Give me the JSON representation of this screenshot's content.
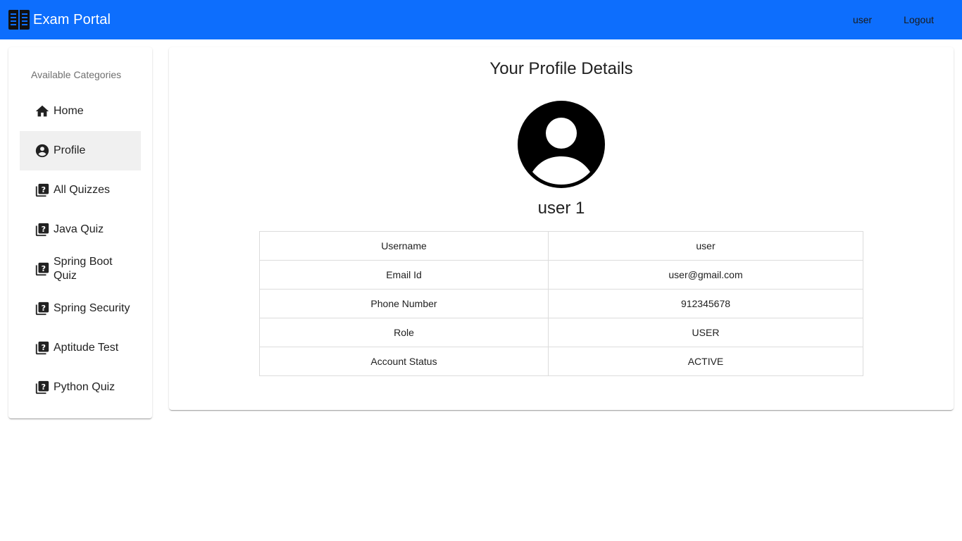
{
  "app": {
    "title": "Exam Portal",
    "brand_icon": "book-icon",
    "accent_color": "#0d6efd"
  },
  "header": {
    "user_label": "user",
    "logout_label": "Logout"
  },
  "sidebar": {
    "heading": "Available Categories",
    "items": [
      {
        "label": "Home",
        "icon": "home-icon"
      },
      {
        "label": "Profile",
        "icon": "account-circle-icon",
        "active": true
      },
      {
        "label": "All Quizzes",
        "icon": "quiz-icon"
      },
      {
        "label": "Java Quiz",
        "icon": "quiz-icon"
      },
      {
        "label": "Spring Boot Quiz",
        "icon": "quiz-icon"
      },
      {
        "label": "Spring Security",
        "icon": "quiz-icon"
      },
      {
        "label": "Aptitude Test",
        "icon": "quiz-icon"
      },
      {
        "label": "Python Quiz",
        "icon": "quiz-icon"
      }
    ]
  },
  "profile": {
    "title": "Your Profile Details",
    "avatar_icon": "account-circle-icon",
    "name": "user 1",
    "rows": [
      {
        "key": "Username",
        "value": "user"
      },
      {
        "key": "Email Id",
        "value": "user@gmail.com"
      },
      {
        "key": "Phone Number",
        "value": "912345678"
      },
      {
        "key": "Role",
        "value": "USER"
      },
      {
        "key": "Account Status",
        "value": "ACTIVE"
      }
    ]
  }
}
